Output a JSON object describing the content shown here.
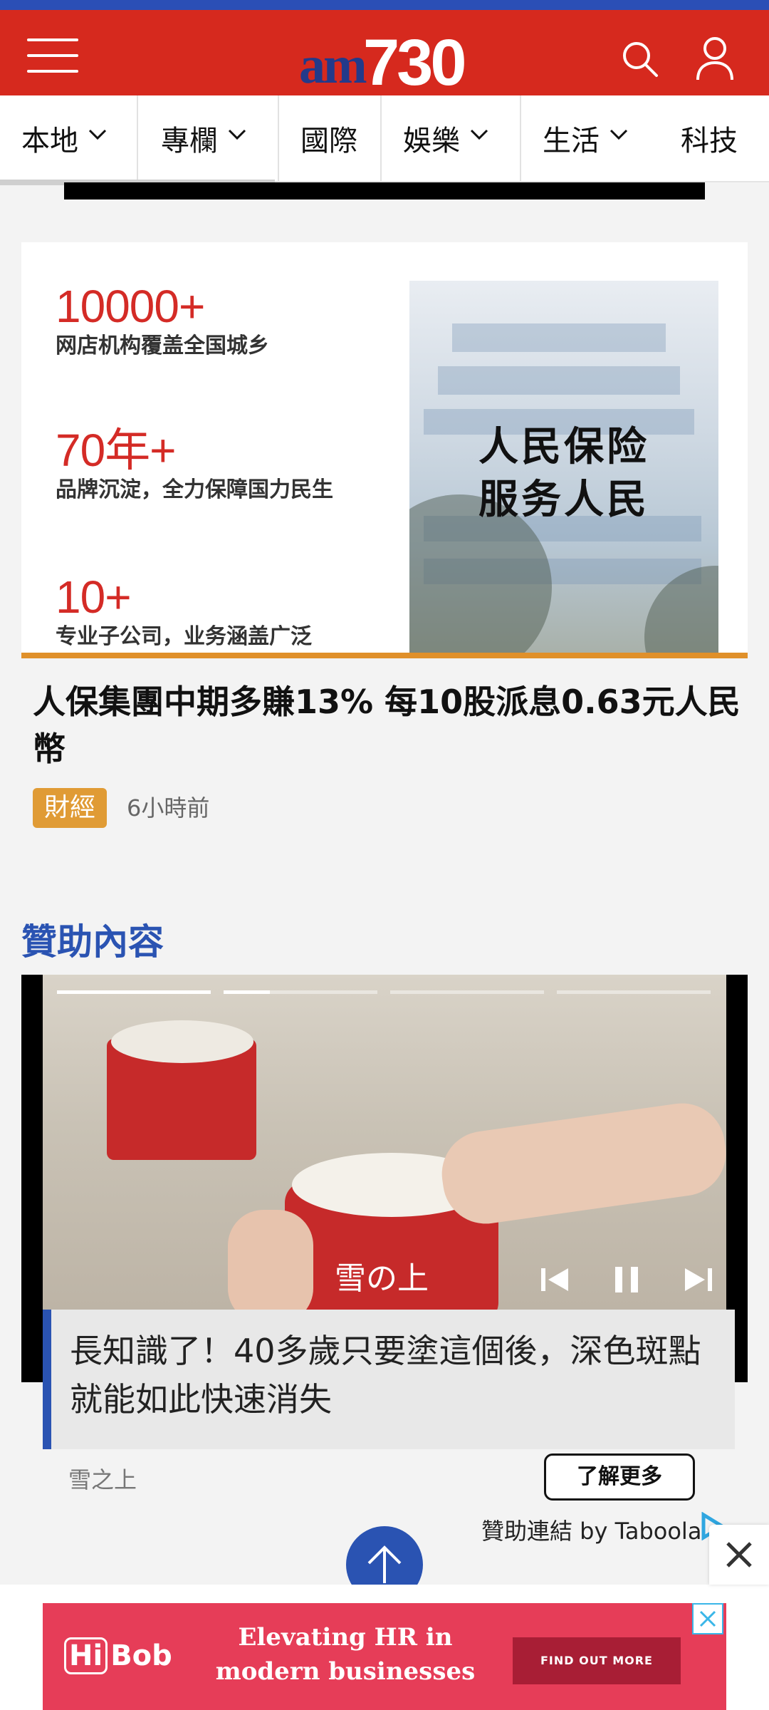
{
  "header": {
    "logo_am": "am",
    "logo_num": "730",
    "colors": {
      "brand_red": "#d6291e",
      "brand_blue": "#2b4fb6"
    },
    "icons": [
      "menu-icon",
      "search-icon",
      "user-icon"
    ]
  },
  "nav": {
    "items": [
      {
        "label": "本地",
        "has_dropdown": true
      },
      {
        "label": "專欄",
        "has_dropdown": true
      },
      {
        "label": "國際",
        "has_dropdown": false
      },
      {
        "label": "娛樂",
        "has_dropdown": true
      },
      {
        "label": "生活",
        "has_dropdown": true
      },
      {
        "label": "科技",
        "has_dropdown": false
      }
    ]
  },
  "article": {
    "image": {
      "stats": [
        {
          "num": "10000+",
          "desc": "网店机构覆盖全国城乡"
        },
        {
          "num": "70年+",
          "desc": "品牌沉淀，全力保障国力民生"
        },
        {
          "num": "10+",
          "desc": "专业子公司，业务涵盖广泛"
        }
      ],
      "slogan_line1": "人民保险",
      "slogan_line2": "服务人民"
    },
    "title": "人保集團中期多賺13% 每10股派息0.63元人民幣",
    "category": "財經",
    "time": "6小時前"
  },
  "sponsored": {
    "heading": "贊助內容",
    "video": {
      "progress": [
        1.0,
        0.3,
        0.0,
        0.0
      ],
      "jar_text": "雪の上"
    },
    "caption": "長知識了！40多歲只要塗這個後，深色斑點就能如此快速消失",
    "brand": "雪之上",
    "cta": "了解更多",
    "attribution": "贊助連結 by Taboola"
  },
  "bottom_ad": {
    "logo_hi": "Hi",
    "logo_bob": "Bob",
    "line1": "Elevating HR in",
    "line2": "modern businesses",
    "button": "FIND OUT MORE"
  }
}
